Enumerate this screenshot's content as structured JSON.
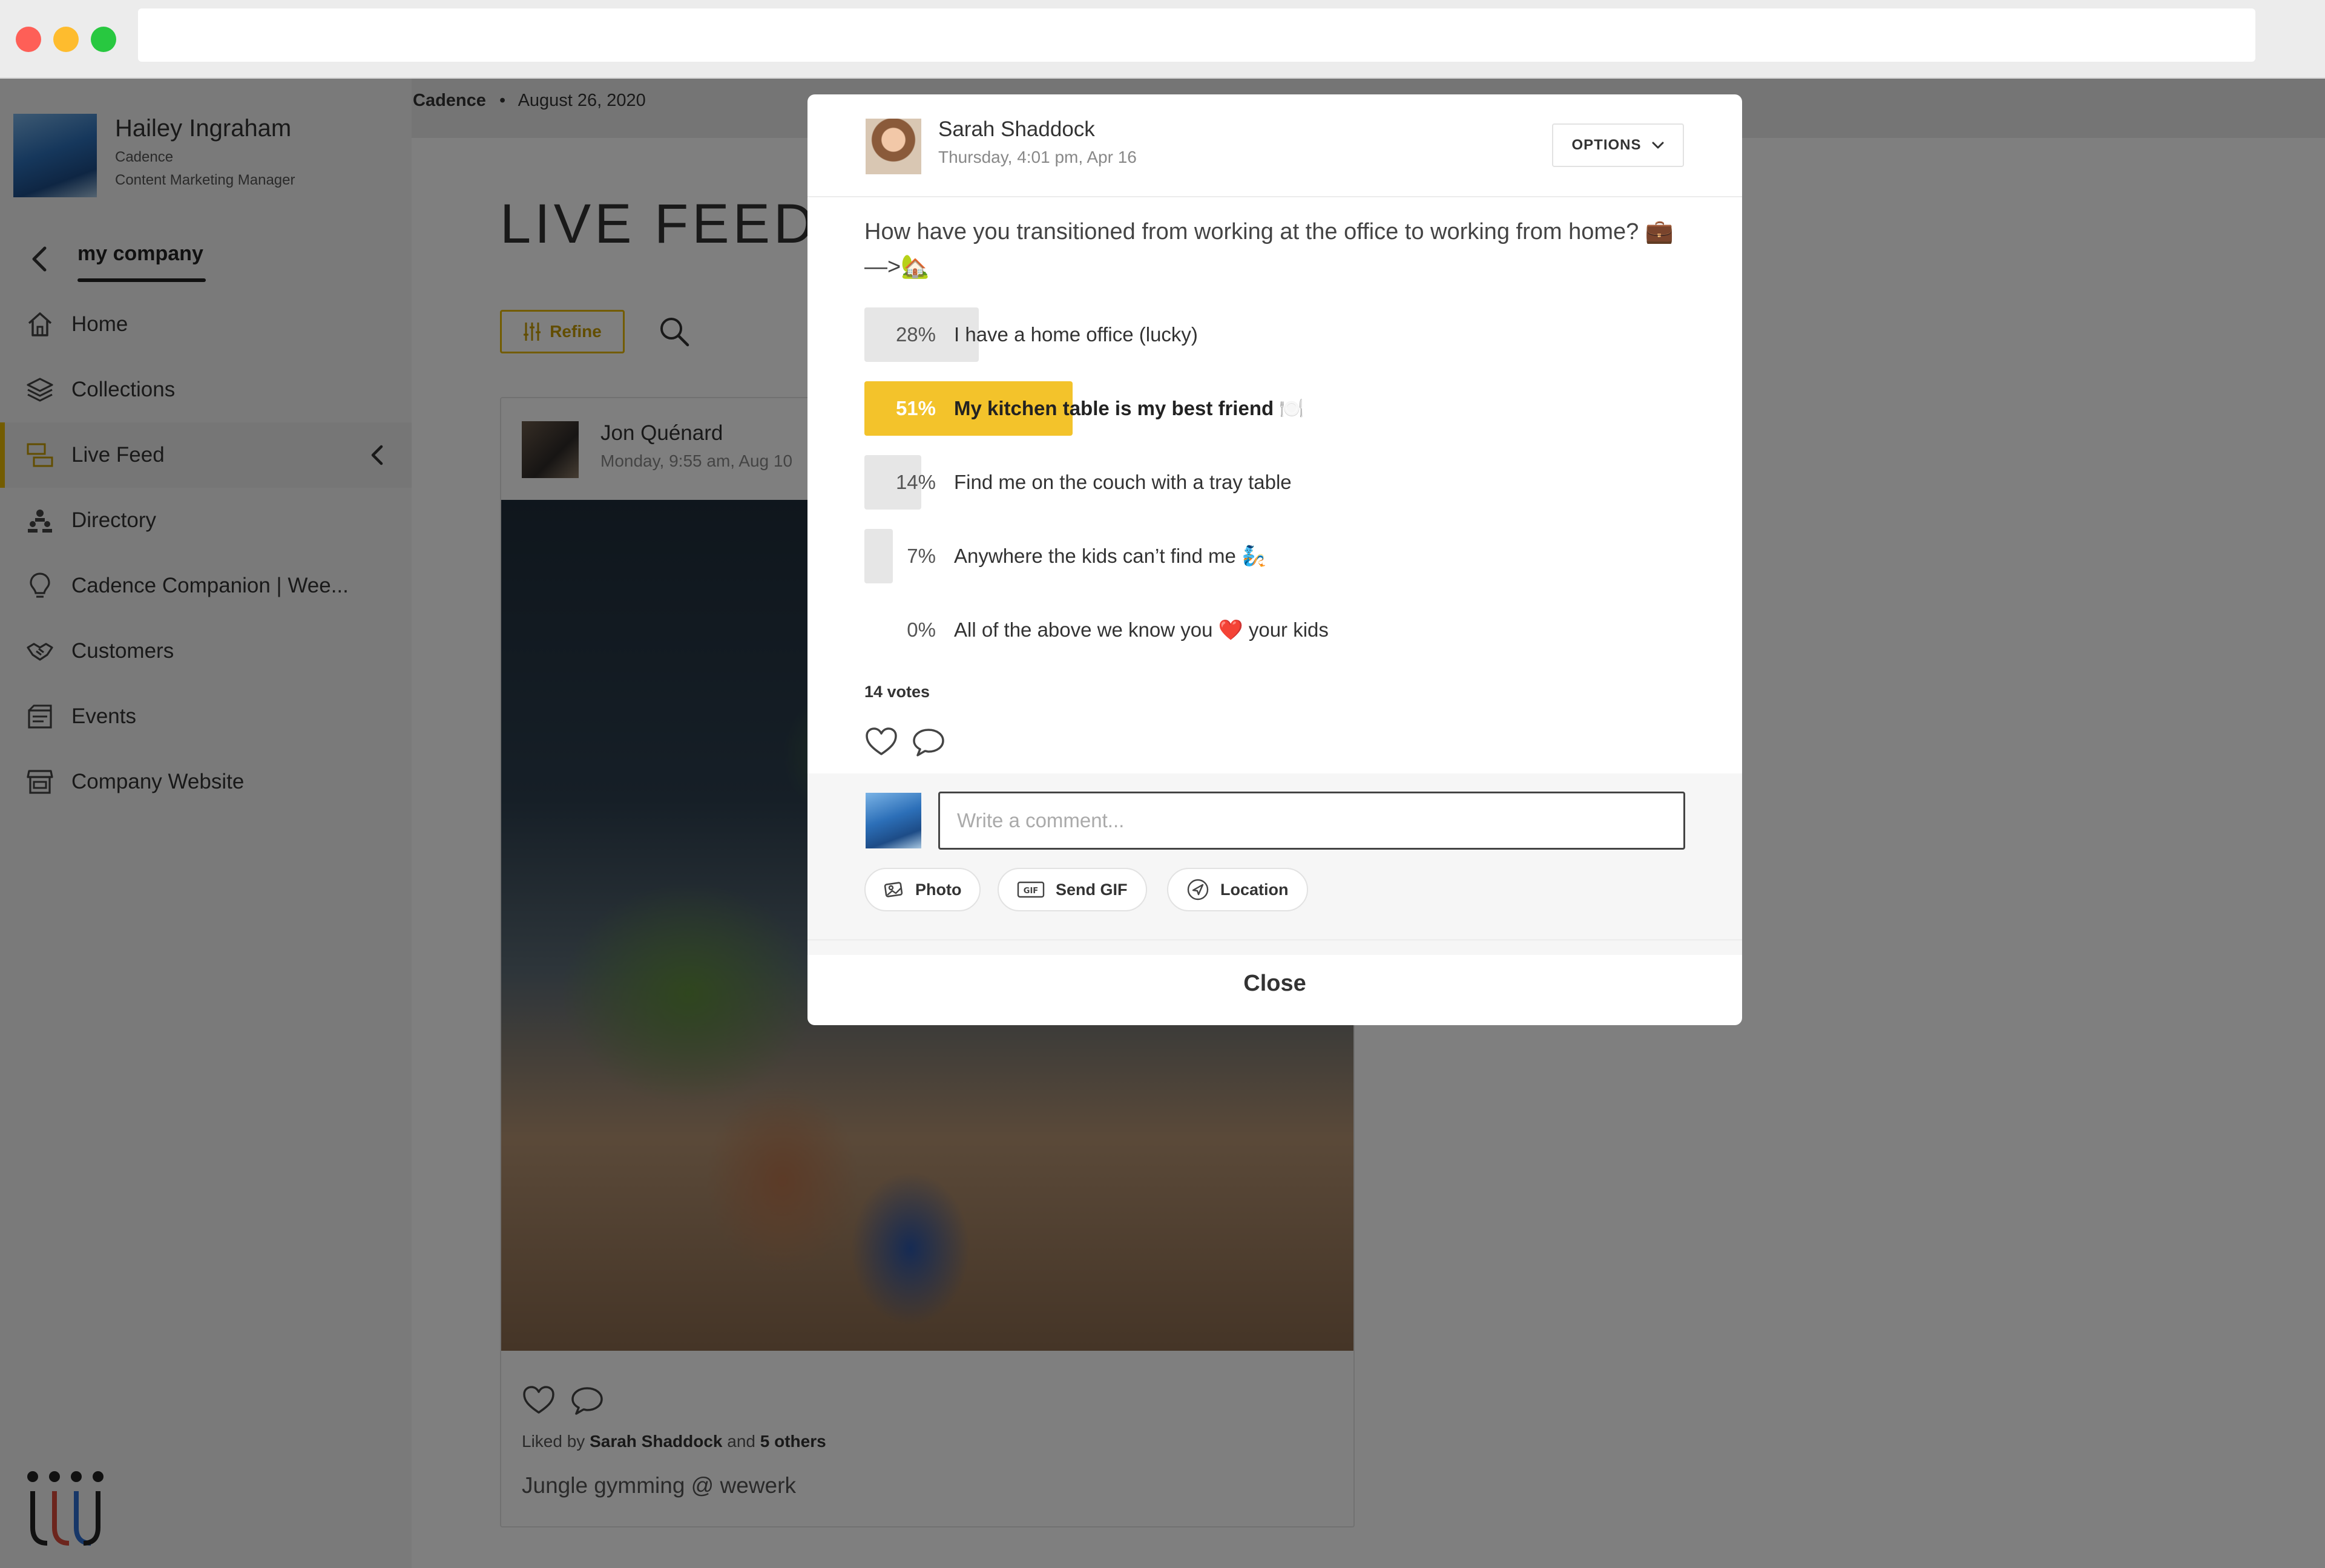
{
  "window": {
    "address": ""
  },
  "profile": {
    "name": "Hailey Ingraham",
    "company": "Cadence",
    "role": "Content Marketing Manager"
  },
  "sidebar": {
    "section_tab": "my company",
    "items": [
      {
        "label": "Home",
        "icon": "home-icon"
      },
      {
        "label": "Collections",
        "icon": "layers-icon"
      },
      {
        "label": "Live Feed",
        "icon": "feed-icon",
        "active": true
      },
      {
        "label": "Directory",
        "icon": "directory-icon"
      },
      {
        "label": "Cadence Companion | Wee...",
        "icon": "lightbulb-icon"
      },
      {
        "label": "Customers",
        "icon": "handshake-icon"
      },
      {
        "label": "Events",
        "icon": "calendar-icon"
      },
      {
        "label": "Company Website",
        "icon": "storefront-icon"
      }
    ]
  },
  "breadcrumb": {
    "company": "Cadence",
    "separator": "•",
    "date": "August 26, 2020"
  },
  "page": {
    "title": "LIVE FEED",
    "refine_label": "Refine"
  },
  "post": {
    "author": "Jon Quénard",
    "time": "Monday, 9:55 am, Aug 10",
    "liked_prefix": "Liked by",
    "liked_name": "Sarah Shaddock",
    "liked_and": "and",
    "liked_others": "5 others",
    "caption": "Jungle gymming @ wewerk"
  },
  "modal": {
    "author": "Sarah Shaddock",
    "time": "Thursday, 4:01 pm, Apr 16",
    "options_label": "OPTIONS",
    "question": "How have you transitioned from working at the office to working from home? 💼 —>🏡",
    "poll": [
      {
        "percent_label": "28%",
        "value": 0.28,
        "label": "I have a home office (lucky)"
      },
      {
        "percent_label": "51%",
        "value": 0.51,
        "label": "My kitchen table is my best friend 🍽️",
        "winner": true
      },
      {
        "percent_label": "14%",
        "value": 0.14,
        "label": "Find me on the couch with a tray table"
      },
      {
        "percent_label": "7%",
        "value": 0.07,
        "label": "Anywhere the kids can’t find me 🧞"
      },
      {
        "percent_label": "0%",
        "value": 0.0,
        "label": "All of the above we know you ❤️ your kids"
      }
    ],
    "votes": "14 votes",
    "comment_placeholder": "Write a comment...",
    "chips": {
      "photo": "Photo",
      "gif": "Send GIF",
      "location": "Location"
    },
    "close_label": "Close"
  },
  "colors": {
    "accent": "#f3c32b",
    "accent_dark": "#c49a00",
    "overlay": "rgba(0,0,0,0.5)"
  }
}
